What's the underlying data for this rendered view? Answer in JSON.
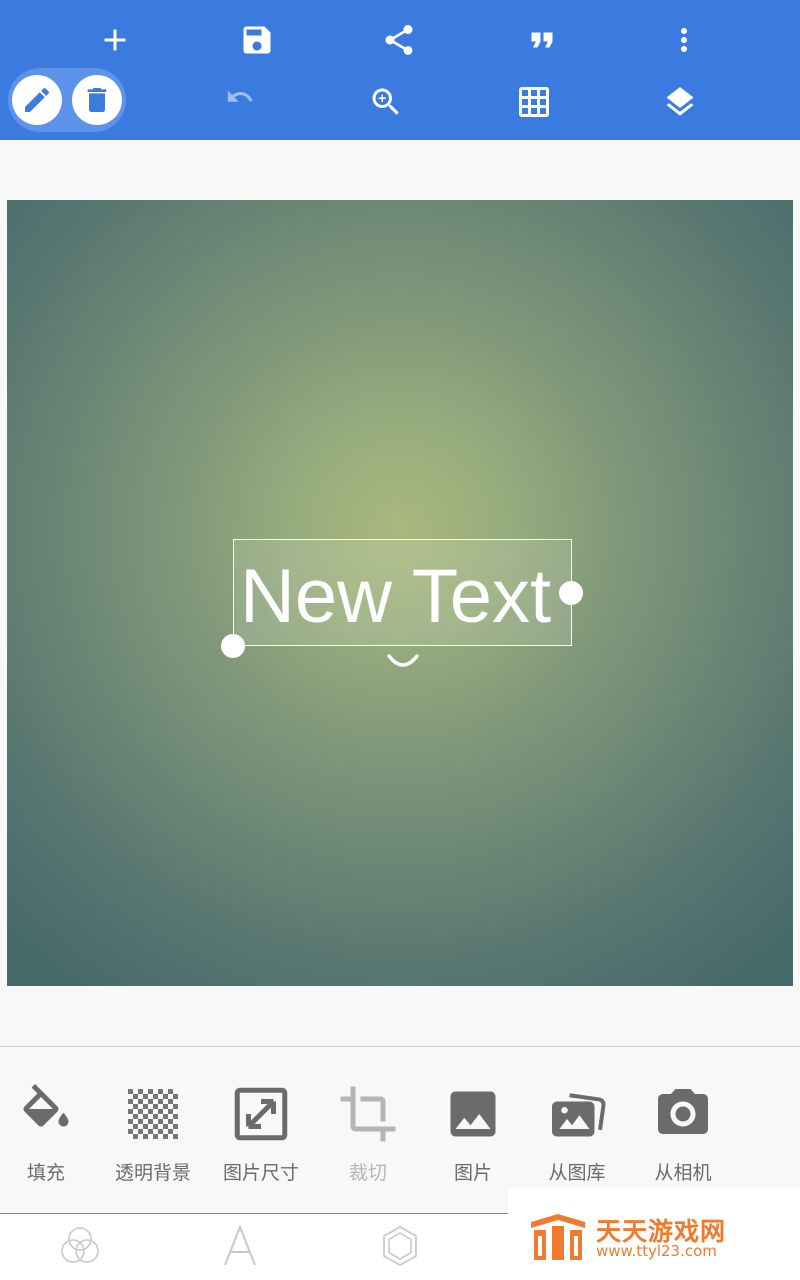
{
  "toolbar": {
    "row1": [
      {
        "name": "add-icon",
        "label": "add"
      },
      {
        "name": "save-icon",
        "label": "save"
      },
      {
        "name": "share-icon",
        "label": "share"
      },
      {
        "name": "quote-icon",
        "label": "quote"
      },
      {
        "name": "more-vert-icon",
        "label": "more"
      }
    ],
    "row2": [
      {
        "name": "undo-icon",
        "label": "undo",
        "enabled": false
      },
      {
        "name": "zoom-in-icon",
        "label": "zoom"
      },
      {
        "name": "grid-icon",
        "label": "grid"
      },
      {
        "name": "layers-icon",
        "label": "layers"
      }
    ],
    "mode_buttons": [
      {
        "name": "pencil-icon",
        "selected": true
      },
      {
        "name": "trash-icon",
        "selected": false
      }
    ]
  },
  "canvas": {
    "text_object": "New Text",
    "text_color": "#ffffff"
  },
  "tools": [
    {
      "icon": "fill-bucket-icon",
      "label": "填充",
      "enabled": true
    },
    {
      "icon": "transparent-checker-icon",
      "label": "透明背景",
      "enabled": true
    },
    {
      "icon": "resize-icon",
      "label": "图片尺寸",
      "enabled": true
    },
    {
      "icon": "crop-icon",
      "label": "裁切",
      "enabled": false
    },
    {
      "icon": "image-icon",
      "label": "图片",
      "enabled": true
    },
    {
      "icon": "gallery-icon",
      "label": "从图库",
      "enabled": true
    },
    {
      "icon": "camera-icon",
      "label": "从相机",
      "enabled": true
    }
  ],
  "tabs": [
    {
      "icon": "color-circles-icon"
    },
    {
      "icon": "text-a-icon"
    },
    {
      "icon": "hexagon-icon"
    }
  ],
  "watermark": {
    "title": "天天游戏网",
    "url": "www.ttyl23.com"
  },
  "colors": {
    "toolbar": "#3b7be0",
    "accent": "#3ba7b8",
    "tool_icon": "#6b6b6b",
    "watermark": "#f07a30"
  }
}
